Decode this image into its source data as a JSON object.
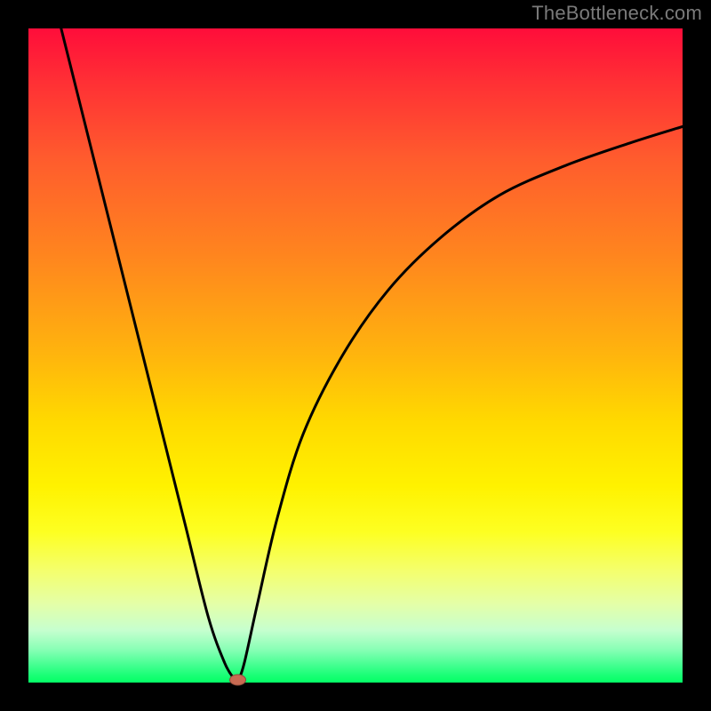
{
  "watermark": {
    "text": "TheBottleneck.com"
  },
  "colors": {
    "frame": "#000000",
    "curve": "#000000",
    "marker_fill": "#c86a52",
    "marker_stroke": "#8a4a3a"
  },
  "chart_data": {
    "type": "line",
    "title": "",
    "xlabel": "",
    "ylabel": "",
    "xlim": [
      0,
      100
    ],
    "ylim": [
      0,
      100
    ],
    "grid": false,
    "legend": false,
    "notes": "V-shaped notch curve on a vertical red→green gradient background. No axes, ticks, or labels are shown. Values below are approximate normalized coordinates read from the image (origin bottom-left, both axes 0–100).",
    "series": [
      {
        "name": "left-branch",
        "x": [
          5.0,
          8.0,
          12.0,
          16.0,
          20.0,
          24.0,
          27.5,
          30.0,
          31.5,
          32.0
        ],
        "y": [
          100.0,
          88.0,
          72.0,
          56.0,
          40.0,
          24.0,
          10.0,
          3.0,
          0.5,
          0.0
        ]
      },
      {
        "name": "right-branch",
        "x": [
          32.0,
          33.0,
          35.0,
          38.0,
          42.0,
          48.0,
          55.0,
          63.0,
          72.0,
          82.0,
          92.0,
          100.0
        ],
        "y": [
          0.0,
          3.0,
          12.0,
          25.0,
          38.0,
          50.0,
          60.0,
          68.0,
          74.5,
          79.0,
          82.5,
          85.0
        ]
      }
    ],
    "marker": {
      "x": 32.0,
      "y": 0.0,
      "shape": "rounded-oval"
    }
  }
}
